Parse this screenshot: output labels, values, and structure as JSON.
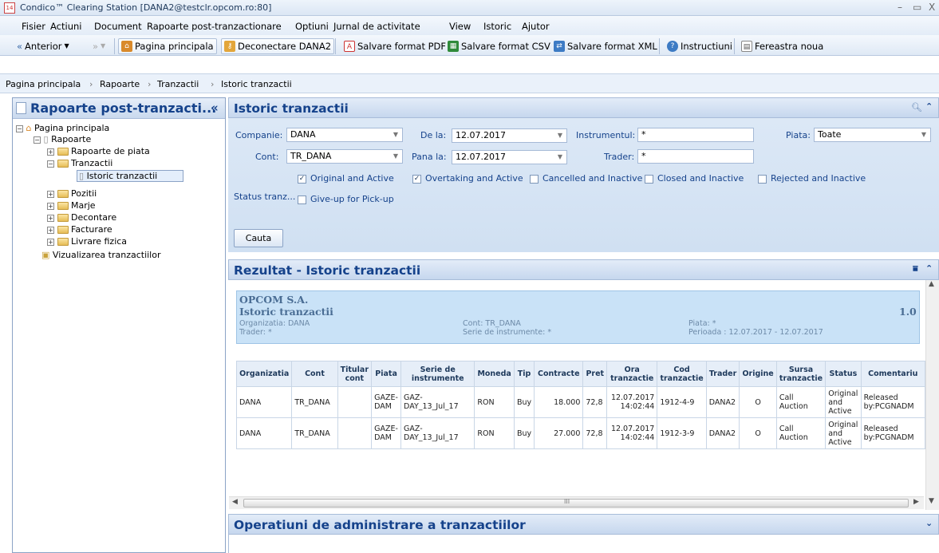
{
  "window": {
    "title": "Condico™ Clearing Station [DANA2@testclr.opcom.ro:80]",
    "minimize": "–",
    "maximize": "▭",
    "close": "X"
  },
  "menu": [
    "Fisier",
    "Actiuni",
    "Document",
    "Rapoarte post-tranzactionare",
    "Optiuni",
    "Jurnal de activitate",
    "View",
    "Istoric",
    "Ajutor"
  ],
  "toolbar": {
    "back": "Anterior",
    "home": "Pagina principala",
    "logout": "Deconectare DANA2",
    "pdf": "Salvare format PDF",
    "csv": "Salvare format CSV",
    "xml": "Salvare format XML",
    "help": "Instructiuni",
    "newwin": "Fereastra noua"
  },
  "breadcrumb": [
    "Pagina principala",
    "Rapoarte",
    "Tranzactii",
    "Istoric tranzactii"
  ],
  "left": {
    "title": "Rapoarte post-tranzacti...",
    "collapse": "«",
    "tree": {
      "root": "Pagina principala",
      "rapoarte": "Rapoarte",
      "piata": "Rapoarte de piata",
      "tranzactii": "Tranzactii",
      "istoric": "Istoric tranzactii",
      "pozitii": "Pozitii",
      "marje": "Marje",
      "decontare": "Decontare",
      "facturare": "Facturare",
      "livrare": "Livrare fizica",
      "vizualizare": "Vizualizarea tranzactiilor"
    }
  },
  "search": {
    "title": "Istoric tranzactii",
    "companie_label": "Companie:",
    "companie": "DANA",
    "cont_label": "Cont:",
    "cont": "TR_DANA",
    "dela_label": "De la:",
    "dela": "12.07.2017",
    "panala_label": "Pana la:",
    "panala": "12.07.2017",
    "instr_label": "Instrumentul:",
    "instr": "*",
    "trader_label": "Trader:",
    "trader": "*",
    "piata_label": "Piata:",
    "piata": "Toate",
    "status_label": "Status tranz...",
    "checks": {
      "orig": "Original and Active",
      "over": "Overtaking and Active",
      "canc": "Cancelled and Inactive",
      "closed": "Closed and Inactive",
      "rej": "Rejected and Inactive",
      "give": "Give-up for Pick-up"
    },
    "check_state": {
      "orig": true,
      "over": true,
      "canc": false,
      "closed": false,
      "rej": false,
      "give": false
    },
    "button": "Cauta"
  },
  "result": {
    "title": "Rezultat - Istoric tranzactii",
    "company": "OPCOM S.A.",
    "report": "Istoric tranzactii",
    "version": "1.0",
    "org": "Organizatia: DANA",
    "trader": "Trader: *",
    "cont": "Cont: TR_DANA",
    "serie": "Serie de instrumente: *",
    "piata": "Piata: *",
    "perioada": "Perioada : 12.07.2017 - 12.07.2017",
    "columns": [
      "Organizatia",
      "Cont",
      "Titular cont",
      "Piata",
      "Serie de instrumente",
      "Moneda",
      "Tip",
      "Contracte",
      "Pret",
      "Ora tranzactie",
      "Cod tranzactie",
      "Trader",
      "Origine",
      "Sursa tranzactie",
      "Status",
      "Comentariu"
    ],
    "rows": [
      [
        "DANA",
        "TR_DANA",
        "",
        "GAZE-DAM",
        "GAZ-DAY_13_Jul_17",
        "RON",
        "Buy",
        "18.000",
        "72,8",
        "12.07.2017 14:02:44",
        "1912-4-9",
        "DANA2",
        "O",
        "Call Auction",
        "Original and Active",
        "Released by:PCGNADM"
      ],
      [
        "DANA",
        "TR_DANA",
        "",
        "GAZE-DAM",
        "GAZ-DAY_13_Jul_17",
        "RON",
        "Buy",
        "27.000",
        "72,8",
        "12.07.2017 14:02:44",
        "1912-3-9",
        "DANA2",
        "O",
        "Call Auction",
        "Original and Active",
        "Released by:PCGNADM"
      ]
    ],
    "scroll_mark": "III"
  },
  "admin": {
    "title": "Operatiuni de administrare a tranzactiilor"
  }
}
